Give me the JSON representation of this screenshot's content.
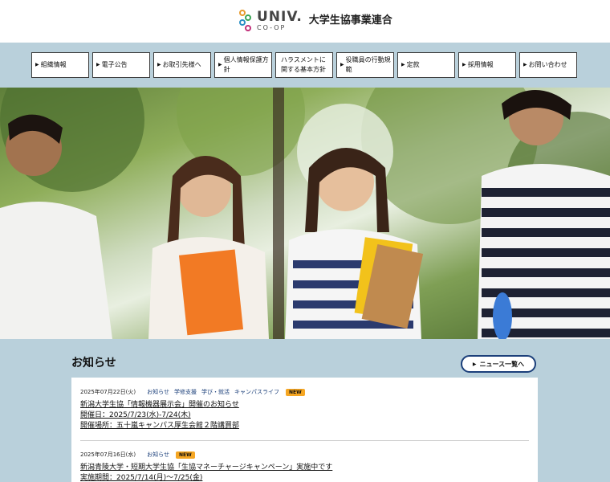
{
  "header": {
    "logo_univ": "UNIV.",
    "logo_coop": "CO-OP",
    "org_name": "大学生協事業連合"
  },
  "nav": {
    "items": [
      {
        "label": "組織情報"
      },
      {
        "label": "電子公告"
      },
      {
        "label": "お取引先様へ"
      },
      {
        "label": "個人情報保護方針"
      },
      {
        "label": "ハラスメントに\n関する基本方針"
      },
      {
        "label": "役職員の行動規範"
      },
      {
        "label": "定款"
      },
      {
        "label": "採用情報"
      },
      {
        "label": "お問い合わせ"
      }
    ]
  },
  "news": {
    "title": "お知らせ",
    "all_button": "ニュース一覧へ",
    "items": [
      {
        "date": "2025年07月22日(火)",
        "categories": [
          "お知らせ",
          "学修支援",
          "学び・就活",
          "キャンパスライフ"
        ],
        "badge": "NEW",
        "title": "新潟大学生協「情報機器展示会」開催のお知らせ",
        "lines": [
          "開催日：2025/7/23(水)-7/24(木)",
          "開催場所：五十嵐キャンパス厚生会館２階講買部"
        ]
      },
      {
        "date": "2025年07月16日(水)",
        "categories": [
          "お知らせ"
        ],
        "badge": "NEW",
        "title": "新潟青陵大学・短期大学生協「生協マネーチャージキャンペーン」実施中です",
        "lines": [
          "実施期間：2025/7/14(月)～7/25(金)"
        ]
      }
    ]
  },
  "colors": {
    "band": "#b9d0db",
    "accent": "#1b3f7a",
    "badge": "#f5a623"
  }
}
